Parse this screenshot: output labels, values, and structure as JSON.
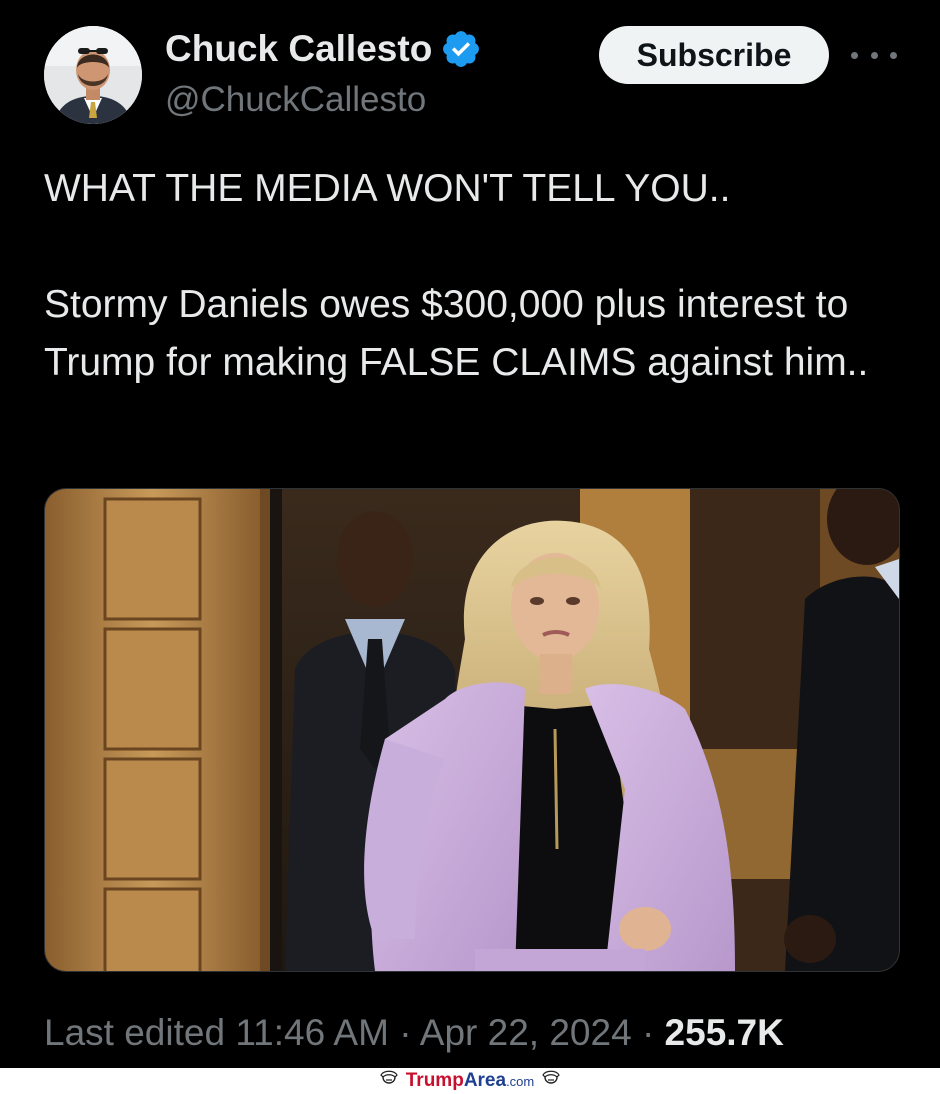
{
  "author": {
    "display_name": "Chuck Callesto",
    "handle": "@ChuckCallesto",
    "verified": true,
    "verified_icon": "verified-badge-icon"
  },
  "actions": {
    "subscribe_label": "Subscribe",
    "more_icon": "more-options-icon"
  },
  "tweet": {
    "paragraphs": [
      "WHAT THE MEDIA WON'T TELL YOU..",
      "Stormy Daniels owes $300,000 plus interest to Trump for making FALSE CLAIMS against him.."
    ]
  },
  "meta": {
    "edited_label": "Last edited",
    "time": "11:46 AM",
    "date": "Apr 22, 2024",
    "separator": "·",
    "views": "255.7K"
  },
  "watermark": {
    "part1": "Trump",
    "part2": "Area",
    "part3": ".com"
  },
  "colors": {
    "background": "#000000",
    "text_primary": "#e7e9ea",
    "text_secondary": "#71767b",
    "verified_blue": "#1d9bf0",
    "button_bg": "#eff3f4"
  }
}
